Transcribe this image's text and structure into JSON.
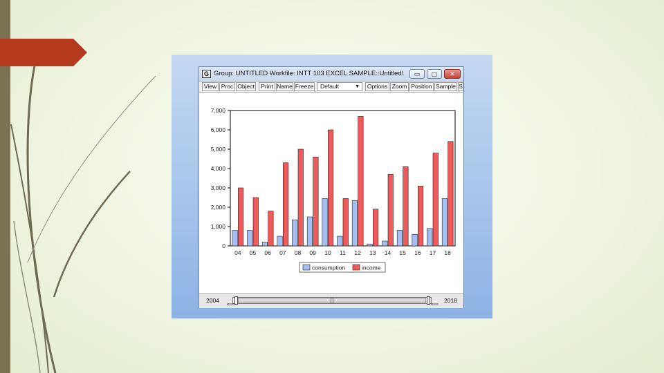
{
  "window": {
    "icon_letter": "G",
    "title": "Group: UNTITLED   Workfile: INTT 103 EXCEL SAMPLE::Untitled\\",
    "controls": {
      "minimize": "▭",
      "maximize": "▢",
      "close": "✕"
    }
  },
  "toolbar": {
    "view": "View",
    "proc": "Proc",
    "object": "Object",
    "print": "Print",
    "name": "Name",
    "freeze": "Freeze",
    "default_select": "Default",
    "options": "Options",
    "zoom": "Zoom",
    "position": "Position",
    "sample": "Sample",
    "overflow": "S"
  },
  "status": {
    "start_year": "2004",
    "end_year": "2018"
  },
  "colors": {
    "consumption": "#a6bef2",
    "income": "#ef5a5a",
    "accent_red": "#b5391c"
  },
  "chart_data": {
    "type": "bar",
    "categories": [
      "04",
      "05",
      "06",
      "07",
      "08",
      "09",
      "10",
      "11",
      "12",
      "13",
      "14",
      "15",
      "16",
      "17",
      "18"
    ],
    "series": [
      {
        "name": "consumption",
        "values": [
          800,
          800,
          200,
          500,
          1350,
          1500,
          2450,
          500,
          2350,
          100,
          250,
          800,
          600,
          900,
          2450
        ]
      },
      {
        "name": "income",
        "values": [
          3000,
          2500,
          1800,
          4300,
          5000,
          4600,
          6000,
          2450,
          6700,
          1900,
          3700,
          4100,
          3100,
          4800,
          5400
        ]
      }
    ],
    "yticks": [
      "0",
      "1,000",
      "2,000",
      "3,000",
      "4,000",
      "5,000",
      "6,000",
      "7,000"
    ],
    "ylim": [
      0,
      7000
    ],
    "legend_position": "bottom-center",
    "grid": false
  }
}
